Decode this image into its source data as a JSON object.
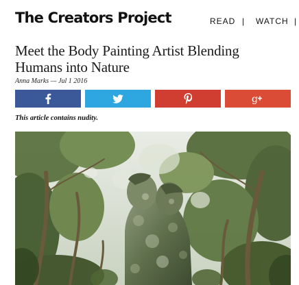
{
  "site": {
    "title": "The Creators Project"
  },
  "nav": {
    "items": [
      {
        "label": "READ"
      },
      {
        "label": "WATCH"
      }
    ],
    "separator": "|"
  },
  "article": {
    "headline": "Meet the Body Painting Artist Blending Humans into Nature",
    "author": "Anna Marks",
    "date_separator": "—",
    "date": "Jul 1 2016",
    "nudity_notice": "This article contains nudity."
  },
  "share": {
    "buttons": [
      {
        "network": "facebook",
        "icon": "facebook-icon",
        "color": "#3b5998"
      },
      {
        "network": "twitter",
        "icon": "twitter-icon",
        "color": "#2ea7e0"
      },
      {
        "network": "pinterest",
        "icon": "pinterest-icon",
        "color": "#cf3e30"
      },
      {
        "network": "googleplus",
        "icon": "google-plus-icon",
        "color": "#db4c36"
      }
    ]
  },
  "hero": {
    "icon": "body-painting-photo"
  }
}
